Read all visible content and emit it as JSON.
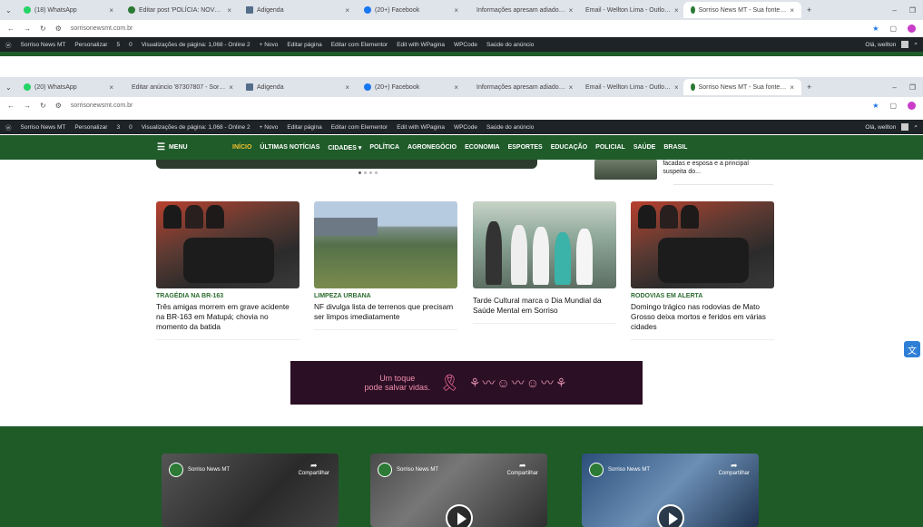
{
  "browser_top": {
    "tabs": [
      {
        "label": "(18) WhatsApp",
        "active": false
      },
      {
        "label": "Editar post 'POLÍCIA: NOV…",
        "active": false
      },
      {
        "label": "Adigenda",
        "active": false
      },
      {
        "label": "(20+) Facebook",
        "active": false
      },
      {
        "label": "Informações apresam adiado…",
        "active": false
      },
      {
        "label": "Email - Wellton Lima - Outlo…",
        "active": false
      },
      {
        "label": "Sorriso News MT - Sua fonte…",
        "active": true
      }
    ],
    "url": "sorrisonewsmt.com.br"
  },
  "browser_bottom": {
    "tabs": [
      {
        "label": "(20) WhatsApp",
        "active": false
      },
      {
        "label": "Editar anúncio '87307807 - Sor…",
        "active": false
      },
      {
        "label": "Adigenda",
        "active": false
      },
      {
        "label": "(20+) Facebook",
        "active": false
      },
      {
        "label": "Informações apresam adiado…",
        "active": false
      },
      {
        "label": "Email - Wellton Lima - Outlo…",
        "active": false
      },
      {
        "label": "Sorriso News MT - Sua fonte…",
        "active": true
      }
    ],
    "url": "sorrisonewsmt.com.br"
  },
  "admin_bar_top": {
    "items": [
      "Sorriso News MT",
      "Personalizar",
      "5",
      "0",
      "Visualizações de página: 1,068 - Online 2",
      "+ Novo",
      "Editar página",
      "Editar com Elementor",
      "Edit with WPagina",
      "WPCode",
      "Saúde do anúncio"
    ],
    "user": "Olá, wellton"
  },
  "admin_bar_bottom": {
    "items": [
      "Sorriso News MT",
      "Personalizar",
      "3",
      "0",
      "Visualizações de página: 1,068 - Online 2",
      "+ Novo",
      "Editar página",
      "Editar com Elementor",
      "Edit with WPagina",
      "WPCode",
      "Saúde do anúncio"
    ],
    "user": "Olá, wellton"
  },
  "nav": {
    "menu_label": "MENU",
    "items": [
      "INÍCIO",
      "ÚLTIMAS NOTÍCIAS",
      "CIDADES ▾",
      "POLÍTICA",
      "AGRONEGÓCIO",
      "ECONOMIA",
      "ESPORTES",
      "EDUCAÇÃO",
      "POLICIAL",
      "SAÚDE",
      "BRASIL"
    ]
  },
  "side_news": {
    "text": "facadas e esposa e a principal suspeita do..."
  },
  "cards": [
    {
      "category": "TRAGÉDIA NA BR-163",
      "title": "Três amigas morrem em grave acidente na BR-163 em Matupá; chovia no momento da batida"
    },
    {
      "category": "LIMPEZA URBANA",
      "title": "NF divulga lista de terrenos que precisam ser limpos imediatamente"
    },
    {
      "category": "",
      "title": "Tarde Cultural marca o Dia Mundial da Saúde Mental em Sorriso"
    },
    {
      "category": "RODOVIAS EM ALERTA",
      "title": "Domingo trágico nas rodovias de Mato Grosso deixa mortos e feridos em várias cidades"
    }
  ],
  "ad": {
    "line1": "Um toque",
    "line2": "pode salvar vidas."
  },
  "videos": [
    {
      "channel": "Sorriso News MT",
      "share": "Compartilhar"
    },
    {
      "channel": "Sorriso News MT",
      "share": "Compartilhar"
    },
    {
      "channel": "Sorriso News MT",
      "share": "Compartilhar"
    }
  ],
  "colors": {
    "nav_green": "#1f5c2a",
    "active_nav": "#f2c230",
    "category_green": "#2c6b2f"
  }
}
